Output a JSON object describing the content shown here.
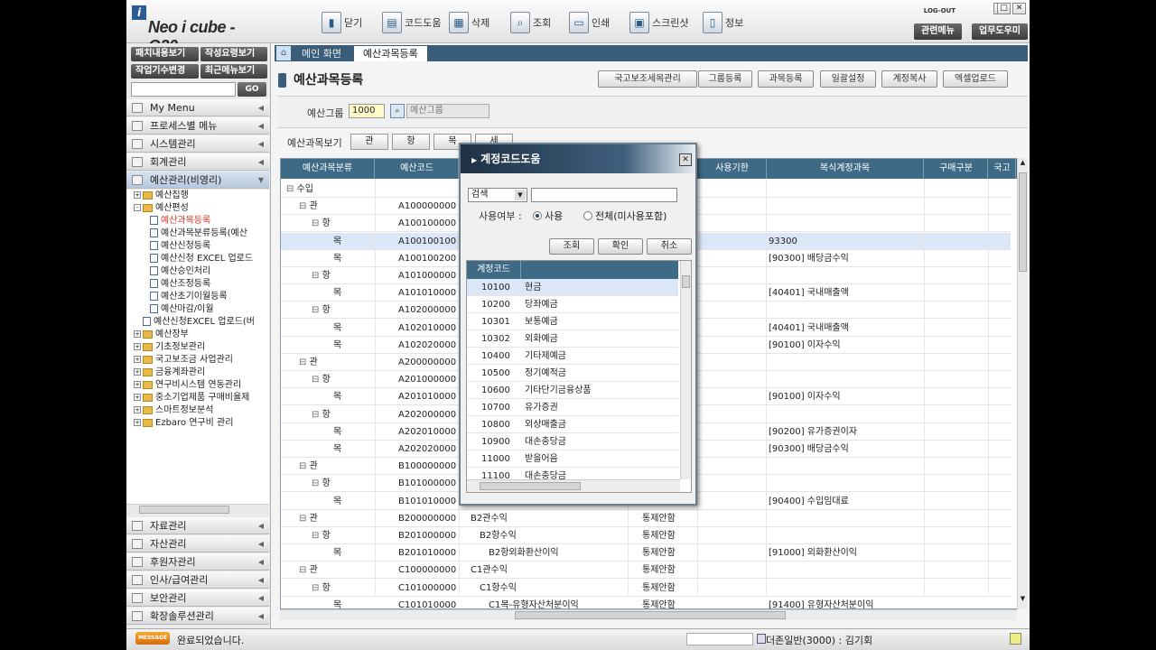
{
  "app": {
    "logo_letter": "i",
    "logo_text": "Neo i cube - G20"
  },
  "toolbar": [
    {
      "icon": "door-exit-icon",
      "label": "닫기",
      "glyph": "▮"
    },
    {
      "icon": "code-help-icon",
      "label": "코드도움",
      "glyph": "▤"
    },
    {
      "icon": "delete-icon",
      "label": "삭제",
      "glyph": "▦"
    },
    {
      "icon": "search-icon",
      "label": "조회",
      "glyph": "⌕"
    },
    {
      "icon": "printer-icon",
      "label": "인쇄",
      "glyph": "▭"
    },
    {
      "icon": "screenshot-icon",
      "label": "스크린샷",
      "glyph": "▣"
    },
    {
      "icon": "info-icon",
      "label": "정보",
      "glyph": "▯"
    }
  ],
  "topright": {
    "logout": "LOG-OUT",
    "related_menu": "관련메뉴",
    "work_help": "업무도우미"
  },
  "left": {
    "btn_patch": "패치내용보기",
    "btn_guide": "작성요령보기",
    "btn_company": "작업기수변경",
    "btn_recent": "최근메뉴보기",
    "search_go": "GO",
    "top_menus": [
      "My Menu",
      "프로세스별 메뉴",
      "시스템관리",
      "회계관리",
      "예산관리(비영리)"
    ],
    "tree": [
      {
        "indent": 0,
        "type": "folder",
        "pm": "+",
        "label": "예산집행"
      },
      {
        "indent": 0,
        "type": "folder",
        "pm": "-",
        "label": "예산편성"
      },
      {
        "indent": 1,
        "type": "doc",
        "label": "예산과목등록",
        "sel": true
      },
      {
        "indent": 1,
        "type": "doc",
        "label": "예산과목분류등록(예산"
      },
      {
        "indent": 1,
        "type": "doc",
        "label": "예산신청등록"
      },
      {
        "indent": 1,
        "type": "doc",
        "label": "예산신청 EXCEL 업로드"
      },
      {
        "indent": 1,
        "type": "doc",
        "label": "예산승인처리"
      },
      {
        "indent": 1,
        "type": "doc",
        "label": "예산조정등록"
      },
      {
        "indent": 1,
        "type": "doc",
        "label": "예산초기이월등록"
      },
      {
        "indent": 1,
        "type": "doc",
        "label": "예산마감/이월"
      },
      {
        "indent": 0,
        "type": "doc",
        "label": "예산신청EXCEL 업로드(버"
      },
      {
        "indent": 0,
        "type": "folder",
        "pm": "+",
        "label": "예산장부"
      },
      {
        "indent": 0,
        "type": "folder",
        "pm": "+",
        "label": "기초정보관리"
      },
      {
        "indent": 0,
        "type": "folder",
        "pm": "+",
        "label": "국고보조금 사업관리"
      },
      {
        "indent": 0,
        "type": "folder",
        "pm": "+",
        "label": "금융계좌관리"
      },
      {
        "indent": 0,
        "type": "folder",
        "pm": "+",
        "label": "연구비시스템 연동관리"
      },
      {
        "indent": 0,
        "type": "folder",
        "pm": "+",
        "label": "중소기업제품 구매비율제"
      },
      {
        "indent": 0,
        "type": "folder",
        "pm": "+",
        "label": "스마트정보분석"
      },
      {
        "indent": 0,
        "type": "folder",
        "pm": "+",
        "label": "Ezbaro 연구비 관리"
      }
    ],
    "bottom_menus": [
      "자료관리",
      "자산관리",
      "후원자관리",
      "인사/급여관리",
      "보안관리",
      "확장솔루션관리"
    ]
  },
  "tabs": [
    "메인 화면",
    "예산과목등록"
  ],
  "page": {
    "title": "예산과목등록",
    "actions": [
      "국고보조세목관리",
      "그룹등록",
      "과목등록",
      "일괄설정",
      "계정복사",
      "엑셀업로드"
    ],
    "budget_group_label": "예산그룹",
    "budget_group_value": "1000",
    "budget_group_name": "예산그룹",
    "view_label": "예산과목보기",
    "view_buttons": [
      "관",
      "항",
      "목",
      "세"
    ]
  },
  "grid": {
    "headers": [
      "예산과목분류",
      "예산코드",
      "",
      "",
      "사용기한",
      "복식계정과목",
      "구매구분",
      "국고"
    ],
    "rows": [
      {
        "lvl": 0,
        "pm": "-",
        "cls": "수입",
        "code": "",
        "name": "",
        "ctrl": "",
        "acct": ""
      },
      {
        "lvl": 1,
        "pm": "-",
        "cls": "관",
        "code": "A100000000",
        "name": "",
        "ctrl": "",
        "acct": ""
      },
      {
        "lvl": 2,
        "pm": "-",
        "cls": "항",
        "code": "A100100000",
        "name": "",
        "ctrl": "",
        "acct": ""
      },
      {
        "lvl": 3,
        "pm": "",
        "cls": "목",
        "code": "A100100100",
        "name": "",
        "ctrl": "",
        "acct": "93300",
        "hl": true
      },
      {
        "lvl": 3,
        "pm": "",
        "cls": "목",
        "code": "A100100200",
        "name": "",
        "ctrl": "",
        "acct": "[90300] 배당금수익"
      },
      {
        "lvl": 2,
        "pm": "-",
        "cls": "항",
        "code": "A101000000",
        "name": "",
        "ctrl": "",
        "acct": ""
      },
      {
        "lvl": 3,
        "pm": "",
        "cls": "목",
        "code": "A101010000",
        "name": "",
        "ctrl": "",
        "acct": "[40401] 국내매출액"
      },
      {
        "lvl": 2,
        "pm": "-",
        "cls": "항",
        "code": "A102000000",
        "name": "",
        "ctrl": "",
        "acct": ""
      },
      {
        "lvl": 3,
        "pm": "",
        "cls": "목",
        "code": "A102010000",
        "name": "",
        "ctrl": "",
        "acct": "[40401] 국내매출액"
      },
      {
        "lvl": 3,
        "pm": "",
        "cls": "목",
        "code": "A102020000",
        "name": "",
        "ctrl": "",
        "acct": "[90100] 이자수익"
      },
      {
        "lvl": 1,
        "pm": "-",
        "cls": "관",
        "code": "A200000000",
        "name": "",
        "ctrl": "",
        "acct": ""
      },
      {
        "lvl": 2,
        "pm": "-",
        "cls": "항",
        "code": "A201000000",
        "name": "",
        "ctrl": "",
        "acct": ""
      },
      {
        "lvl": 3,
        "pm": "",
        "cls": "목",
        "code": "A201010000",
        "name": "",
        "ctrl": "",
        "acct": "[90100] 이자수익"
      },
      {
        "lvl": 2,
        "pm": "-",
        "cls": "항",
        "code": "A202000000",
        "name": "",
        "ctrl": "",
        "acct": ""
      },
      {
        "lvl": 3,
        "pm": "",
        "cls": "목",
        "code": "A202010000",
        "name": "",
        "ctrl": "",
        "acct": "[90200] 유가증권이자"
      },
      {
        "lvl": 3,
        "pm": "",
        "cls": "목",
        "code": "A202020000",
        "name": "",
        "ctrl": "",
        "acct": "[90300] 배당금수익"
      },
      {
        "lvl": 1,
        "pm": "-",
        "cls": "관",
        "code": "B100000000",
        "name": "",
        "ctrl": "",
        "acct": ""
      },
      {
        "lvl": 2,
        "pm": "-",
        "cls": "항",
        "code": "B101000000",
        "name": "",
        "ctrl": "",
        "acct": ""
      },
      {
        "lvl": 3,
        "pm": "",
        "cls": "목",
        "code": "B101010000",
        "name": "",
        "ctrl": "",
        "acct": "[90400] 수입임대료"
      },
      {
        "lvl": 1,
        "pm": "-",
        "cls": "관",
        "code": "B200000000",
        "name": "B2관수익",
        "ctrl": "통제안함",
        "acct": ""
      },
      {
        "lvl": 2,
        "pm": "-",
        "cls": "항",
        "code": "B201000000",
        "name": "B2항수익",
        "ctrl": "통제안함",
        "acct": ""
      },
      {
        "lvl": 3,
        "pm": "",
        "cls": "목",
        "code": "B201010000",
        "name": "B2항외화환산이익",
        "ctrl": "통제안함",
        "acct": "[91000] 외화환산이익"
      },
      {
        "lvl": 1,
        "pm": "-",
        "cls": "관",
        "code": "C100000000",
        "name": "C1관수익",
        "ctrl": "통제안함",
        "acct": ""
      },
      {
        "lvl": 2,
        "pm": "-",
        "cls": "항",
        "code": "C101000000",
        "name": "C1항수익",
        "ctrl": "통제안함",
        "acct": ""
      },
      {
        "lvl": 3,
        "pm": "",
        "cls": "목",
        "code": "C101010000",
        "name": "C1목-유형자산처분이익",
        "ctrl": "통제안함",
        "acct": "[91400] 유형자산처분이익"
      }
    ]
  },
  "popup": {
    "title": "계정코드도움",
    "search_select": "검색",
    "usage_label": "사용여부 :",
    "opt_use": "사용",
    "opt_all": "전체(미사용포함)",
    "btn_search": "조회",
    "btn_ok": "확인",
    "btn_cancel": "취소",
    "col_code": "계정코드",
    "rows": [
      {
        "code": "10100",
        "name": "현금"
      },
      {
        "code": "10200",
        "name": "당좌예금"
      },
      {
        "code": "10301",
        "name": "보통예금"
      },
      {
        "code": "10302",
        "name": "외화예금"
      },
      {
        "code": "10400",
        "name": "기타제예금"
      },
      {
        "code": "10500",
        "name": "정기예적금"
      },
      {
        "code": "10600",
        "name": "기타단기금융상품"
      },
      {
        "code": "10700",
        "name": "유가증권"
      },
      {
        "code": "10800",
        "name": "외상매출금"
      },
      {
        "code": "10900",
        "name": "대손충당금"
      },
      {
        "code": "11000",
        "name": "받을어음"
      },
      {
        "code": "11100",
        "name": "대손충당금"
      }
    ]
  },
  "status": {
    "badge": "MESSAGE",
    "message": "완료되었습니다.",
    "user": "더존일반(3000) : 김기회"
  }
}
